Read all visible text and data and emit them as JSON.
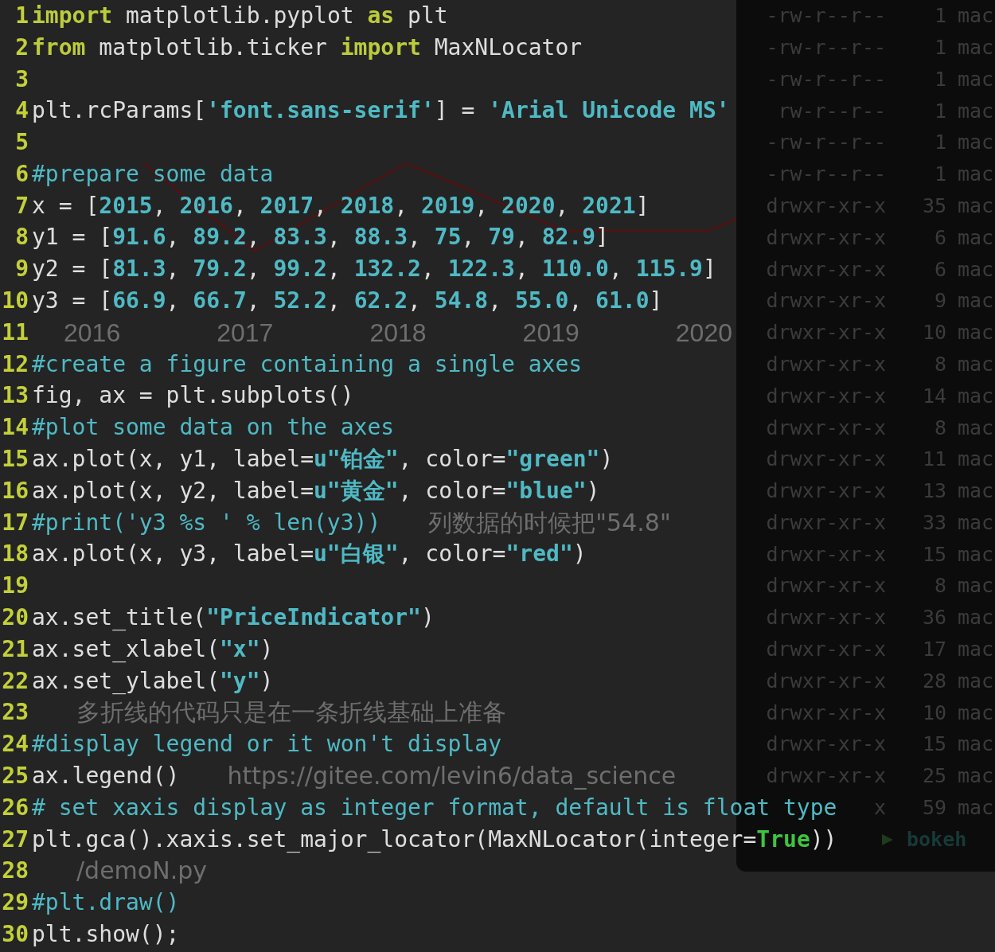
{
  "editor": {
    "lines": [
      {
        "number": "1",
        "tokens": [
          {
            "kind": "keyword",
            "text": "import"
          },
          {
            "kind": "plain",
            "text": " matplotlib.pyplot "
          },
          {
            "kind": "keyword",
            "text": "as"
          },
          {
            "kind": "plain",
            "text": " plt"
          }
        ]
      },
      {
        "number": "2",
        "tokens": [
          {
            "kind": "keyword",
            "text": "from"
          },
          {
            "kind": "plain",
            "text": " matplotlib.ticker "
          },
          {
            "kind": "keyword",
            "text": "import"
          },
          {
            "kind": "plain",
            "text": " MaxNLocator"
          }
        ]
      },
      {
        "number": "3"
      },
      {
        "number": "4",
        "tokens": [
          {
            "kind": "plain",
            "text": "plt.rcParams["
          },
          {
            "kind": "string",
            "text": "'font.sans-serif'"
          },
          {
            "kind": "plain",
            "text": "] = "
          },
          {
            "kind": "string",
            "text": "'Arial Unicode MS'"
          }
        ]
      },
      {
        "number": "5"
      },
      {
        "number": "6",
        "tokens": [
          {
            "kind": "comment",
            "text": "#prepare some data"
          }
        ]
      },
      {
        "number": "7",
        "tokens": [
          {
            "kind": "plain",
            "text": "x = ["
          },
          {
            "kind": "number",
            "text": "2015"
          },
          {
            "kind": "plain",
            "text": ", "
          },
          {
            "kind": "number",
            "text": "2016"
          },
          {
            "kind": "plain",
            "text": ", "
          },
          {
            "kind": "number",
            "text": "2017"
          },
          {
            "kind": "plain",
            "text": ", "
          },
          {
            "kind": "number",
            "text": "2018"
          },
          {
            "kind": "plain",
            "text": ", "
          },
          {
            "kind": "number",
            "text": "2019"
          },
          {
            "kind": "plain",
            "text": ", "
          },
          {
            "kind": "number",
            "text": "2020"
          },
          {
            "kind": "plain",
            "text": ", "
          },
          {
            "kind": "number",
            "text": "2021"
          },
          {
            "kind": "plain",
            "text": "]"
          }
        ]
      },
      {
        "number": "8",
        "tokens": [
          {
            "kind": "plain",
            "text": "y1 = ["
          },
          {
            "kind": "number",
            "text": "91.6"
          },
          {
            "kind": "plain",
            "text": ", "
          },
          {
            "kind": "number",
            "text": "89.2"
          },
          {
            "kind": "plain",
            "text": ", "
          },
          {
            "kind": "number",
            "text": "83.3"
          },
          {
            "kind": "plain",
            "text": ", "
          },
          {
            "kind": "number",
            "text": "88.3"
          },
          {
            "kind": "plain",
            "text": ", "
          },
          {
            "kind": "number",
            "text": "75"
          },
          {
            "kind": "plain",
            "text": ", "
          },
          {
            "kind": "number",
            "text": "79"
          },
          {
            "kind": "plain",
            "text": ", "
          },
          {
            "kind": "number",
            "text": "82.9"
          },
          {
            "kind": "plain",
            "text": "]"
          }
        ]
      },
      {
        "number": "9",
        "tokens": [
          {
            "kind": "plain",
            "text": "y2 = ["
          },
          {
            "kind": "number",
            "text": "81.3"
          },
          {
            "kind": "plain",
            "text": ", "
          },
          {
            "kind": "number",
            "text": "79.2"
          },
          {
            "kind": "plain",
            "text": ", "
          },
          {
            "kind": "number",
            "text": "99.2"
          },
          {
            "kind": "plain",
            "text": ", "
          },
          {
            "kind": "number",
            "text": "132.2"
          },
          {
            "kind": "plain",
            "text": ", "
          },
          {
            "kind": "number",
            "text": "122.3"
          },
          {
            "kind": "plain",
            "text": ", "
          },
          {
            "kind": "number",
            "text": "110.0"
          },
          {
            "kind": "plain",
            "text": ", "
          },
          {
            "kind": "number",
            "text": "115.9"
          },
          {
            "kind": "plain",
            "text": "]"
          }
        ]
      },
      {
        "number": "10",
        "tokens": [
          {
            "kind": "plain",
            "text": "y3 = ["
          },
          {
            "kind": "number",
            "text": "66.9"
          },
          {
            "kind": "plain",
            "text": ", "
          },
          {
            "kind": "number",
            "text": "66.7"
          },
          {
            "kind": "plain",
            "text": ", "
          },
          {
            "kind": "number",
            "text": "52.2"
          },
          {
            "kind": "plain",
            "text": ", "
          },
          {
            "kind": "number",
            "text": "62.2"
          },
          {
            "kind": "plain",
            "text": ", "
          },
          {
            "kind": "number",
            "text": "54.8"
          },
          {
            "kind": "plain",
            "text": ", "
          },
          {
            "kind": "number",
            "text": "55.0"
          },
          {
            "kind": "plain",
            "text": ", "
          },
          {
            "kind": "number",
            "text": "61.0"
          },
          {
            "kind": "plain",
            "text": "]"
          }
        ]
      },
      {
        "number": "11",
        "axis_labels": [
          "2016",
          "2017",
          "2018",
          "2019",
          "2020"
        ]
      },
      {
        "number": "12",
        "tokens": [
          {
            "kind": "comment",
            "text": "#create a figure containing a single axes"
          }
        ]
      },
      {
        "number": "13",
        "tokens": [
          {
            "kind": "plain",
            "text": "fig, ax = plt.subplots()"
          }
        ]
      },
      {
        "number": "14",
        "tokens": [
          {
            "kind": "comment",
            "text": "#plot some data on the axes"
          }
        ]
      },
      {
        "number": "15",
        "tokens": [
          {
            "kind": "plain",
            "text": "ax.plot(x, y1, label="
          },
          {
            "kind": "string",
            "text": "u\"铂金\""
          },
          {
            "kind": "plain",
            "text": ", color="
          },
          {
            "kind": "string",
            "text": "\"green\""
          },
          {
            "kind": "plain",
            "text": ")"
          }
        ]
      },
      {
        "number": "16",
        "tokens": [
          {
            "kind": "plain",
            "text": "ax.plot(x, y2, label="
          },
          {
            "kind": "string",
            "text": "u\"黄金\""
          },
          {
            "kind": "plain",
            "text": ", color="
          },
          {
            "kind": "string",
            "text": "\"blue\""
          },
          {
            "kind": "plain",
            "text": ")"
          }
        ]
      },
      {
        "number": "17",
        "tokens": [
          {
            "kind": "comment",
            "text": "#print('y3 %s ' % len(y3))"
          }
        ],
        "ghost": "列数据的时候把\"54.8\""
      },
      {
        "number": "18",
        "tokens": [
          {
            "kind": "plain",
            "text": "ax.plot(x, y3, label="
          },
          {
            "kind": "string",
            "text": "u\"白银\""
          },
          {
            "kind": "plain",
            "text": ", color="
          },
          {
            "kind": "string",
            "text": "\"red\""
          },
          {
            "kind": "plain",
            "text": ")"
          }
        ]
      },
      {
        "number": "19"
      },
      {
        "number": "20",
        "tokens": [
          {
            "kind": "plain",
            "text": "ax.set_title("
          },
          {
            "kind": "string",
            "text": "\"PriceIndicator\""
          },
          {
            "kind": "plain",
            "text": ")"
          }
        ]
      },
      {
        "number": "21",
        "tokens": [
          {
            "kind": "plain",
            "text": "ax.set_xlabel("
          },
          {
            "kind": "string",
            "text": "\"x\""
          },
          {
            "kind": "plain",
            "text": ")"
          }
        ]
      },
      {
        "number": "22",
        "tokens": [
          {
            "kind": "plain",
            "text": "ax.set_ylabel("
          },
          {
            "kind": "string",
            "text": "\"y\""
          },
          {
            "kind": "plain",
            "text": ")"
          }
        ]
      },
      {
        "number": "23",
        "ghost": "多折线的代码只是在一条折线基础上准备"
      },
      {
        "number": "24",
        "tokens": [
          {
            "kind": "comment",
            "text": "#display legend or it won't display"
          }
        ]
      },
      {
        "number": "25",
        "tokens": [
          {
            "kind": "plain",
            "text": "ax.legend()"
          }
        ],
        "ghost": "https://gitee.com/levin6/data_science"
      },
      {
        "number": "26",
        "tokens": [
          {
            "kind": "comment",
            "text": "# set xaxis display as integer format, default is float type"
          }
        ]
      },
      {
        "number": "27",
        "tokens": [
          {
            "kind": "plain",
            "text": "plt.gca().xaxis.set_major_locator(MaxNLocator(integer="
          },
          {
            "kind": "bool",
            "text": "True"
          },
          {
            "kind": "plain",
            "text": "))"
          }
        ]
      },
      {
        "number": "28",
        "ghost": "/demoN.py"
      },
      {
        "number": "29",
        "tokens": [
          {
            "kind": "comment",
            "text": "#plt.draw()"
          }
        ]
      },
      {
        "number": "30",
        "tokens": [
          {
            "kind": "plain",
            "text": "plt.show();"
          }
        ]
      }
    ]
  },
  "terminal": {
    "rows": [
      {
        "permissions": "-rw-r--r--",
        "links": "1",
        "owner": "mac"
      },
      {
        "permissions": "-rw-r--r--",
        "links": "1",
        "owner": "mac"
      },
      {
        "permissions": "-rw-r--r--",
        "links": "1",
        "owner": "mac"
      },
      {
        "permissions": "rw-r--r--",
        "links": "1",
        "owner": "mac"
      },
      {
        "permissions": "-rw-r--r--",
        "links": "1",
        "owner": "mac"
      },
      {
        "permissions": "-rw-r--r--",
        "links": "1",
        "owner": "mac"
      },
      {
        "permissions": "drwxr-xr-x",
        "links": "35",
        "owner": "mac"
      },
      {
        "permissions": "drwxr-xr-x",
        "links": "6",
        "owner": "mac"
      },
      {
        "permissions": "drwxr-xr-x",
        "links": "6",
        "owner": "mac"
      },
      {
        "permissions": "drwxr-xr-x",
        "links": "9",
        "owner": "mac"
      },
      {
        "permissions": "drwxr-xr-x",
        "links": "10",
        "owner": "mac"
      },
      {
        "permissions": "drwxr-xr-x",
        "links": "8",
        "owner": "mac"
      },
      {
        "permissions": "drwxr-xr-x",
        "links": "14",
        "owner": "mac"
      },
      {
        "permissions": "drwxr-xr-x",
        "links": "8",
        "owner": "mac"
      },
      {
        "permissions": "drwxr-xr-x",
        "links": "11",
        "owner": "mac"
      },
      {
        "permissions": "drwxr-xr-x",
        "links": "13",
        "owner": "mac"
      },
      {
        "permissions": "drwxr-xr-x",
        "links": "33",
        "owner": "mac"
      },
      {
        "permissions": "drwxr-xr-x",
        "links": "15",
        "owner": "mac"
      },
      {
        "permissions": "drwxr-xr-x",
        "links": "8",
        "owner": "mac"
      },
      {
        "permissions": "drwxr-xr-x",
        "links": "36",
        "owner": "mac"
      },
      {
        "permissions": "drwxr-xr-x",
        "links": "17",
        "owner": "mac"
      },
      {
        "permissions": "drwxr-xr-x",
        "links": "28",
        "owner": "mac"
      },
      {
        "permissions": "drwxr-xr-x",
        "links": "10",
        "owner": "mac"
      },
      {
        "permissions": "drwxr-xr-x",
        "links": "15",
        "owner": "mac"
      },
      {
        "permissions": "drwxr-xr-x",
        "links": "25",
        "owner": "mac"
      },
      {
        "permissions": "x",
        "links": "59",
        "owner": "mac"
      }
    ],
    "prompt": "bokeh"
  }
}
